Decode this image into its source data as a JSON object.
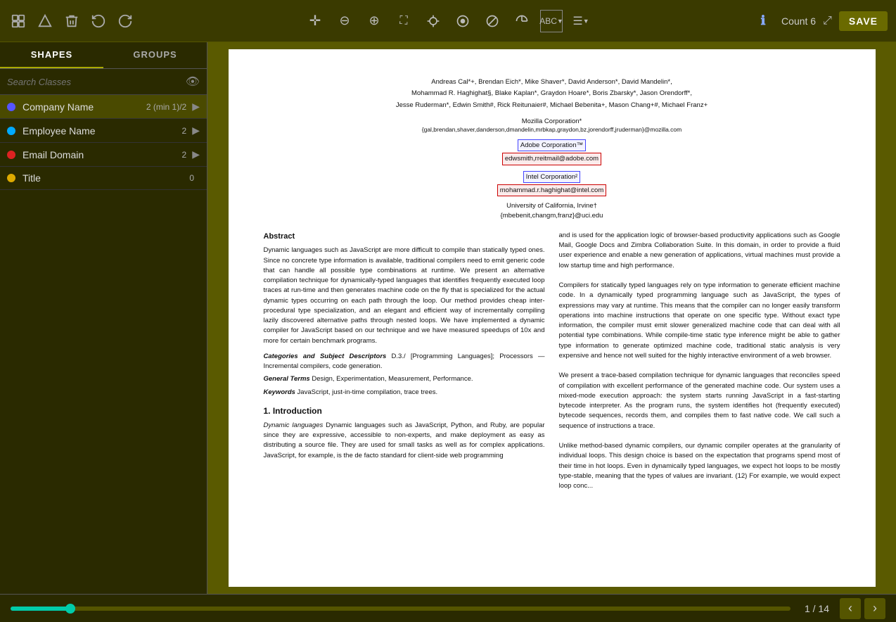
{
  "toolbar": {
    "tools": [
      {
        "name": "select-tool",
        "icon": "⬡",
        "label": "Select"
      },
      {
        "name": "shape-tool",
        "icon": "△",
        "label": "Shape"
      },
      {
        "name": "delete-tool",
        "icon": "🗑",
        "label": "Delete"
      },
      {
        "name": "undo-tool",
        "icon": "↺",
        "label": "Undo"
      },
      {
        "name": "redo-tool",
        "icon": "↻",
        "label": "Redo"
      }
    ],
    "center_tools": [
      {
        "name": "move-tool",
        "icon": "✛"
      },
      {
        "name": "zoom-out-tool",
        "icon": "🔍-"
      },
      {
        "name": "zoom-in-tool",
        "icon": "🔍+"
      },
      {
        "name": "fit-tool",
        "icon": "⛶"
      },
      {
        "name": "crosshair-tool",
        "icon": "⊕"
      },
      {
        "name": "circle-tool",
        "icon": "◉"
      },
      {
        "name": "slash-tool",
        "icon": "⊘"
      },
      {
        "name": "arc-tool",
        "icon": "◔"
      },
      {
        "name": "text-tool",
        "icon": "ABC"
      },
      {
        "name": "menu-tool",
        "icon": "☰"
      }
    ],
    "info_icon": "ℹ",
    "count_label": "Count 6",
    "expand_icon": "⤢",
    "save_label": "SAVE"
  },
  "sidebar": {
    "tab_shapes": "SHAPES",
    "tab_groups": "GROUPS",
    "search_placeholder": "Search Classes",
    "classes": [
      {
        "name": "Company Name",
        "color": "#5555ff",
        "count": "2 (min 1)/2",
        "has_arrow": true
      },
      {
        "name": "Employee Name",
        "color": "#00aaff",
        "count": "2",
        "has_arrow": true
      },
      {
        "name": "Email Domain",
        "color": "#dd2222",
        "count": "2",
        "has_arrow": true
      },
      {
        "name": "Title",
        "color": "#ddaa00",
        "count": "0",
        "has_arrow": false
      }
    ]
  },
  "document": {
    "authors_line1": "Andreas Cal*+, Brendan Eich*, Mike Shaver*, David Anderson*, David Mandelin*,",
    "authors_line2": "Mohammad R. Haghighat§, Blake Kaplan*, Graydon Hoare*, Boris Zbarsky*, Jason Orendorff*,",
    "authors_line3": "Jesse Ruderman*, Edwin Smith#, Rick Reitunaier#, Michael Bebenita+, Mason Chang+#, Michael Franz+",
    "affil_mozilla": "Mozilla Corporation*",
    "affil_mozilla_email": "{gal,brendan,shaver,danderson,dmandelin,mrbkap,graydon,bz,jorendorff,jruderman}@mozilla.com",
    "company1_name": "Adobe Corporation™",
    "company1_email": "edwsmith,rreitmail@adobe.com",
    "company2_name": "Intel Corporation²",
    "company2_email": "mohammad.r.haghighat@intel.com",
    "affil_uci": "University of California, Irvine†",
    "affil_uci_email": "{mbebenit,changm,franz}@uci.edu",
    "abstract_heading": "Abstract",
    "abstract_text": "Dynamic languages such as JavaScript are more difficult to compile than statically typed ones. Since no concrete type information is available, traditional compilers need to emit generic code that can handle all possible type combinations at runtime. We present an alternative compilation technique for dynamically-typed languages that identifies frequently executed loop traces at run-time and then generates machine code on the fly that is specialized for the actual dynamic types occurring on each path through the loop. Our method provides cheap inter-procedural type specialization, and an elegant and efficient way of incrementally compiling lazily discovered alternative paths through nested loops. We have implemented a dynamic compiler for JavaScript based on our technique and we have measured speedups of 10x and more for certain benchmark programs.",
    "categories_label": "Categories and Subject Descriptors",
    "categories_value": "D.3./ [Programming Languages]; Processors — Incremental compilers, code generation.",
    "general_terms_label": "General Terms",
    "general_terms_value": "Design, Experimentation, Measurement, Performance.",
    "keywords_label": "Keywords",
    "keywords_value": "JavaScript, just-in-time compilation, trace trees.",
    "intro_heading": "1.    Introduction",
    "intro_text": "Dynamic languages such as JavaScript, Python, and Ruby, are popular since they are expressive, accessible to non-experts, and make deployment as easy as distributing a source file. They are used for small tasks as well as for complex applications. JavaScript, for example, is the de facto standard for client-side web programming",
    "right_col_text": "and is used for the application logic of browser-based productivity applications such as Google Mail, Google Docs and Zimbra Collaboration Suite. In this domain, in order to provide a fluid user experience and enable a new generation of applications, virtual machines must provide a low startup time and high performance.\n\nCompilers for statically typed languages rely on type information to generate efficient machine code. In a dynamically typed programming language such as JavaScript, the types of expressions may vary at runtime. This means that the compiler can no longer easily transform operations into machine instructions that operate on one specific type. Without exact type information, the compiler must emit slower generalized machine code that can deal with all potential type combinations. While compile-time static type inference might be able to gather type information to generate optimized machine code, traditional static analysis is very expensive and hence not well suited for the highly interactive environment of a web browser.\n\nWe present a trace-based compilation technique for dynamic languages that reconciles speed of compilation with excellent performance of the generated machine code. Our system uses a mixed-mode execution approach: the system starts running JavaScript in a fast-starting bytecode interpreter. As the program runs, the system identifies hot (frequently executed) bytecode sequences, records them, and compiles them to fast native code. We call such a sequence of instructions a trace.\n\nUnlike method-based dynamic compilers, our dynamic compiler operates at the granularity of individual loops. This design choice is based on the expectation that programs spend most of their time in hot loops. Even in dynamically typed languages, we expect hot loops to be mostly type-stable, meaning that the types of values are invariant. (12) For example, we would expect loop conc..."
  },
  "statusbar": {
    "progress_percent": 8,
    "page_current": "1",
    "page_total": "14",
    "page_label": "1 / 14"
  }
}
